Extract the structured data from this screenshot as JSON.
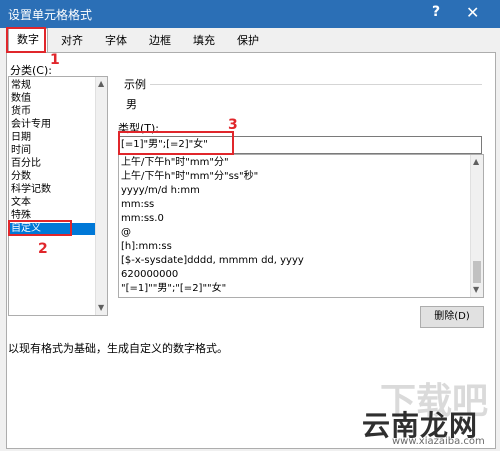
{
  "window": {
    "title": "设置单元格格式",
    "help_glyph": "?",
    "close_glyph": "✕"
  },
  "tabs": [
    {
      "label": "数字"
    },
    {
      "label": "对齐"
    },
    {
      "label": "字体"
    },
    {
      "label": "边框"
    },
    {
      "label": "填充"
    },
    {
      "label": "保护"
    }
  ],
  "category": {
    "label": "分类(C):",
    "items": [
      "常规",
      "数值",
      "货币",
      "会计专用",
      "日期",
      "时间",
      "百分比",
      "分数",
      "科学记数",
      "文本",
      "特殊",
      "自定义"
    ],
    "selected": "自定义"
  },
  "sample": {
    "label": "示例",
    "value": "男"
  },
  "type_field": {
    "label": "类型(T):",
    "value": "[=1]\"男\";[=2]\"女\""
  },
  "format_list": [
    "上午/下午h\"时\"mm\"分\"",
    "上午/下午h\"时\"mm\"分\"ss\"秒\"",
    "yyyy/m/d h:mm",
    "mm:ss",
    "mm:ss.0",
    "@",
    "[h]:mm:ss",
    "[$-x-sysdate]dddd, mmmm dd, yyyy",
    "620000000",
    "\"[=1]\"\"男\";\"[=2]\"\"女\""
  ],
  "delete_button": "删除(D)",
  "description": "以现有格式为基础，生成自定义的数字格式。",
  "annotations": [
    "1",
    "2",
    "3"
  ],
  "watermark": {
    "brand": "云南龙网",
    "url": "www.xiazaiba.com",
    "faint": "下载吧"
  },
  "colors": {
    "titlebar": "#2b6fb6",
    "selection": "#0078d7",
    "annotation_red": "#e0262b"
  }
}
